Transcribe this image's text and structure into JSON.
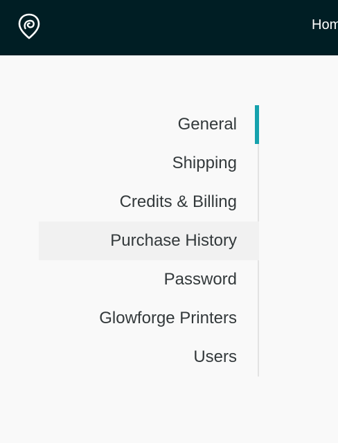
{
  "header": {
    "logo_icon": "glowforge-logo-icon",
    "nav_home": "Home",
    "accent": "#16a2ad",
    "background": "#001e24"
  },
  "menu": {
    "items": [
      {
        "label": "General",
        "state": "active"
      },
      {
        "label": "Shipping",
        "state": "normal"
      },
      {
        "label": "Credits & Billing",
        "state": "normal"
      },
      {
        "label": "Purchase History",
        "state": "hover"
      },
      {
        "label": "Password",
        "state": "normal"
      },
      {
        "label": "Glowforge Printers",
        "state": "normal"
      },
      {
        "label": "Users",
        "state": "normal"
      }
    ]
  }
}
